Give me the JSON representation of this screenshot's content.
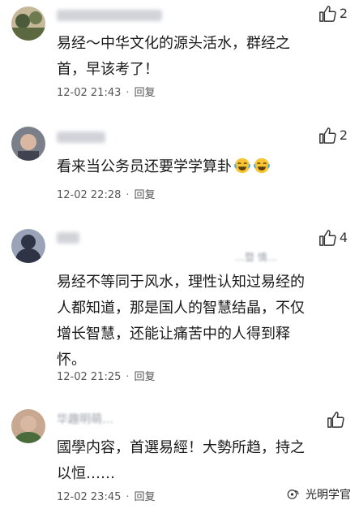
{
  "comments": [
    {
      "text": "易经～中华文化的源头活水，群经之\n首，早该考了！",
      "time": "12-02 21:43",
      "reply": "回复",
      "likes": "2",
      "avatar_colors": [
        "#4b5a3a",
        "#c8b89a"
      ]
    },
    {
      "text": "看来当公务员还要学学算卦",
      "time": "12-02 22:28",
      "reply": "回复",
      "likes": "2",
      "avatar_colors": [
        "#7a7f8a",
        "#d9b7a0"
      ]
    },
    {
      "text": "易经不等同于风水，理性认知过易经的\n人都知道，那是国人的智慧结晶，不仅\n增长智慧，还能让痛苦中的人得到释\n怀。",
      "time": "12-02 21:25",
      "reply": "回复",
      "likes": "4",
      "username_fragment": "…暨 情…",
      "avatar_colors": [
        "#2e3346",
        "#9aa3b8"
      ]
    },
    {
      "text": "國學内容，首選易經！大勢所趋，持之\n以恒……",
      "time": "12-02 23:45",
      "reply": "回复",
      "likes": "",
      "username_fragment": "华趣明萌…",
      "avatar_colors": [
        "#c8a890",
        "#4a6b3a"
      ]
    }
  ],
  "footer": {
    "brand": "光明学官",
    "icon": "wechat-official-account-icon"
  }
}
